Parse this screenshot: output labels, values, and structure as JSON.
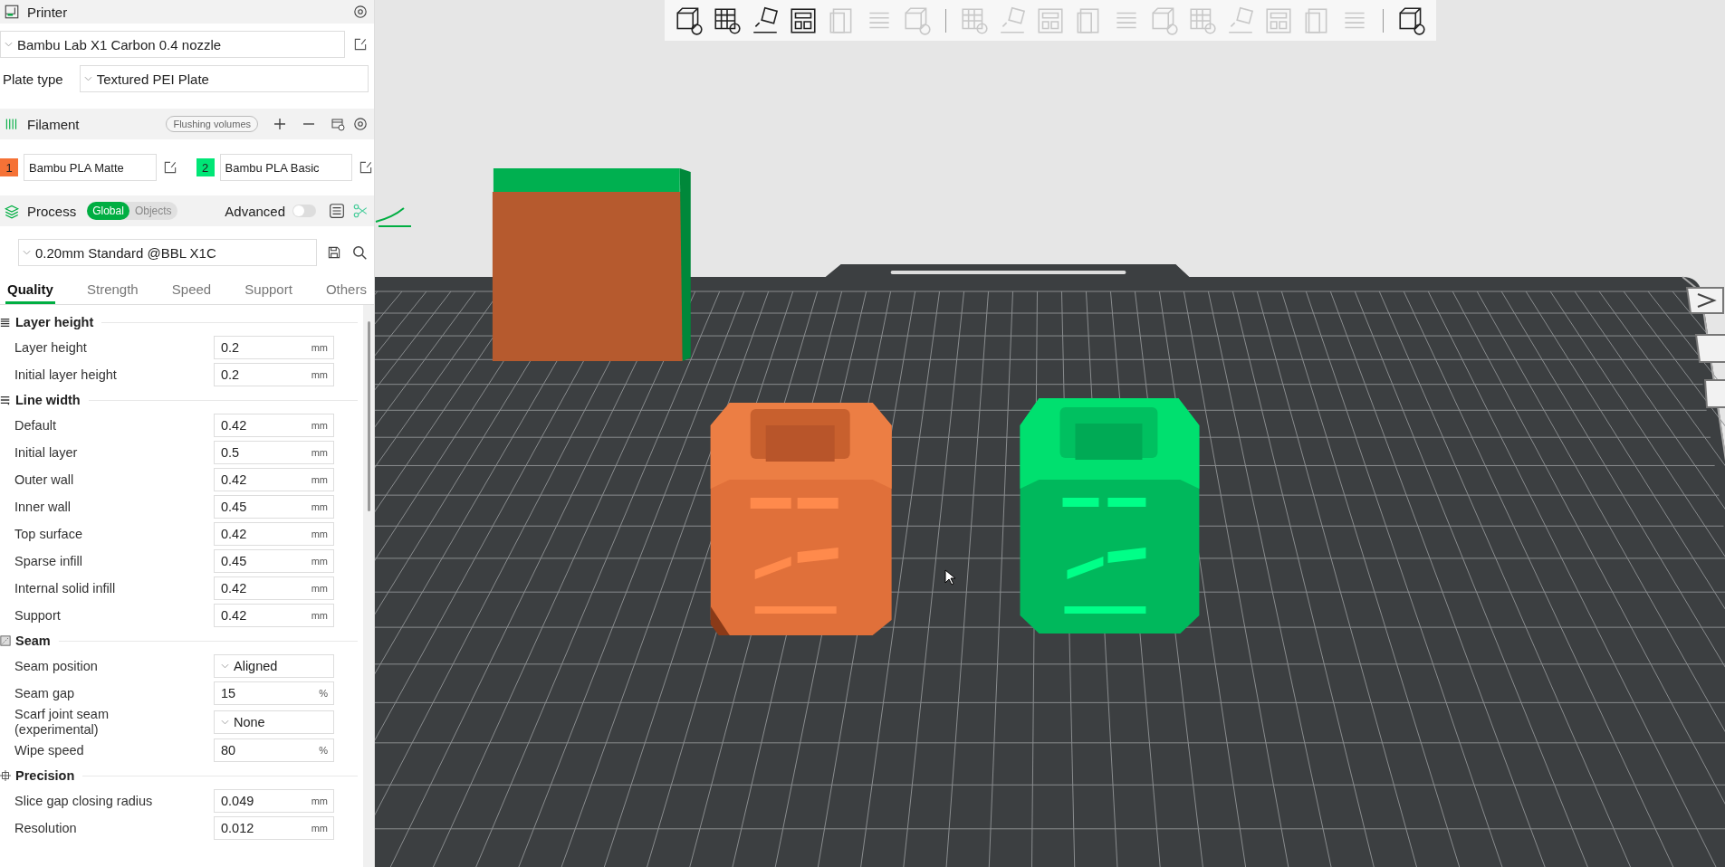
{
  "printer": {
    "title": "Printer",
    "preset": "Bambu Lab X1 Carbon 0.4 nozzle",
    "plate_label": "Plate type",
    "plate_value": "Textured PEI Plate"
  },
  "filament": {
    "title": "Filament",
    "flush_button": "Flushing volumes",
    "items": [
      {
        "number": "1",
        "color": "#f57236",
        "name": "Bambu PLA Matte"
      },
      {
        "number": "2",
        "color": "#00e676",
        "name": "Bambu PLA Basic"
      }
    ]
  },
  "process": {
    "title": "Process",
    "scopes": [
      {
        "label": "Global",
        "selected": true
      },
      {
        "label": "Objects",
        "selected": false
      }
    ],
    "advanced_label": "Advanced",
    "advanced_on": false,
    "preset": "0.20mm Standard @BBL X1C",
    "tabs": [
      {
        "label": "Quality",
        "selected": true
      },
      {
        "label": "Strength",
        "selected": false
      },
      {
        "label": "Speed",
        "selected": false
      },
      {
        "label": "Support",
        "selected": false
      },
      {
        "label": "Others",
        "selected": false
      }
    ],
    "groups": [
      {
        "kind": "layers",
        "title": "Layer height",
        "rows": [
          {
            "label": "Layer height",
            "kind": "number",
            "value": "0.2",
            "unit": "mm"
          },
          {
            "label": "Initial layer height",
            "kind": "number",
            "value": "0.2",
            "unit": "mm"
          }
        ]
      },
      {
        "kind": "lines",
        "title": "Line width",
        "rows": [
          {
            "label": "Default",
            "kind": "number",
            "value": "0.42",
            "unit": "mm"
          },
          {
            "label": "Initial layer",
            "kind": "number",
            "value": "0.5",
            "unit": "mm"
          },
          {
            "label": "Outer wall",
            "kind": "number",
            "value": "0.42",
            "unit": "mm"
          },
          {
            "label": "Inner wall",
            "kind": "number",
            "value": "0.45",
            "unit": "mm"
          },
          {
            "label": "Top surface",
            "kind": "number",
            "value": "0.42",
            "unit": "mm"
          },
          {
            "label": "Sparse infill",
            "kind": "number",
            "value": "0.45",
            "unit": "mm"
          },
          {
            "label": "Internal solid infill",
            "kind": "number",
            "value": "0.42",
            "unit": "mm"
          },
          {
            "label": "Support",
            "kind": "number",
            "value": "0.42",
            "unit": "mm"
          }
        ]
      },
      {
        "kind": "seam",
        "title": "Seam",
        "rows": [
          {
            "label": "Seam position",
            "kind": "dropdown",
            "value": "Aligned"
          },
          {
            "label": "Seam gap",
            "kind": "number",
            "value": "15",
            "unit": "%"
          },
          {
            "label": "Scarf joint seam (experimental)",
            "kind": "dropdown",
            "value": "None"
          },
          {
            "label": "Wipe speed",
            "kind": "number",
            "value": "80",
            "unit": "%"
          }
        ]
      },
      {
        "kind": "precision",
        "title": "Precision",
        "rows": [
          {
            "label": "Slice gap closing radius",
            "kind": "number",
            "value": "0.049",
            "unit": "mm"
          },
          {
            "label": "Resolution",
            "kind": "number",
            "value": "0.012",
            "unit": "mm"
          }
        ]
      }
    ]
  },
  "toolbar": [
    {
      "disabled": false
    },
    {
      "disabled": false
    },
    {
      "disabled": false
    },
    {
      "disabled": false
    },
    {
      "disabled": true
    },
    {
      "disabled": true
    },
    {
      "disabled": true
    },
    {
      "disabled": true
    },
    {
      "disabled": true
    },
    {
      "disabled": true
    },
    {
      "disabled": true
    },
    {
      "disabled": true
    },
    {
      "disabled": true
    },
    {
      "disabled": true
    },
    {
      "disabled": true
    },
    {
      "disabled": true
    },
    {
      "disabled": true
    },
    {
      "disabled": true
    },
    {
      "disabled": false
    }
  ]
}
